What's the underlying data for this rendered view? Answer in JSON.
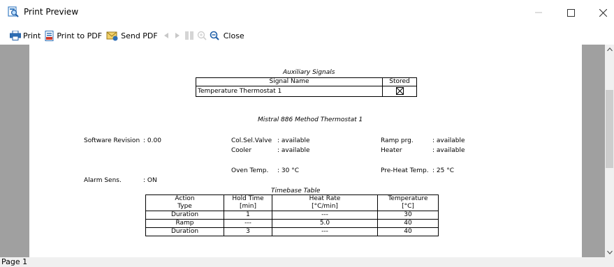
{
  "window": {
    "title": "Print Preview",
    "icons": {
      "app": "print-preview-icon",
      "minimize": "minimize-icon",
      "maximize": "maximize-icon",
      "close": "close-icon"
    }
  },
  "toolbar": {
    "print_label": "Print",
    "print_pdf_label": "Print to PDF",
    "send_pdf_label": "Send PDF",
    "close_label": "Close"
  },
  "document": {
    "aux_signals": {
      "title": "Auxiliary Signals",
      "headers": [
        "Signal Name",
        "Stored"
      ],
      "rows": [
        {
          "name": "Temperature Thermostat 1",
          "stored": "checked-box"
        }
      ]
    },
    "method_title": "Mistral 886 Method Thermostat 1",
    "params": {
      "software_revision_label": "Software Revision",
      "software_revision_value": ": 0.00",
      "colsel_label": "Col.Sel.Valve",
      "colsel_value": ": available",
      "ramp_label": "Ramp prg.",
      "ramp_value": ": available",
      "cooler_label": "Cooler",
      "cooler_value": ": available",
      "heater_label": "Heater",
      "heater_value": ": available",
      "oven_label": "Oven Temp.",
      "oven_value": ": 30 °C",
      "preheat_label": "Pre-Heat Temp.",
      "preheat_value": ": 25 °C",
      "alarm_label": "Alarm Sens.",
      "alarm_value": ": ON"
    },
    "timebase": {
      "title": "Timebase Table",
      "headers": [
        [
          "Action",
          "Type"
        ],
        [
          "Hold Time",
          "[min]"
        ],
        [
          "Heat Rate",
          "[°C/min]"
        ],
        [
          "Temperature",
          "[°C]"
        ]
      ],
      "rows": [
        [
          "Duration",
          "1",
          "---",
          "30"
        ],
        [
          "Ramp",
          "---",
          "5.0",
          "40"
        ],
        [
          "Duration",
          "3",
          "---",
          "40"
        ]
      ]
    }
  },
  "status": {
    "page_label": "Page 1"
  }
}
